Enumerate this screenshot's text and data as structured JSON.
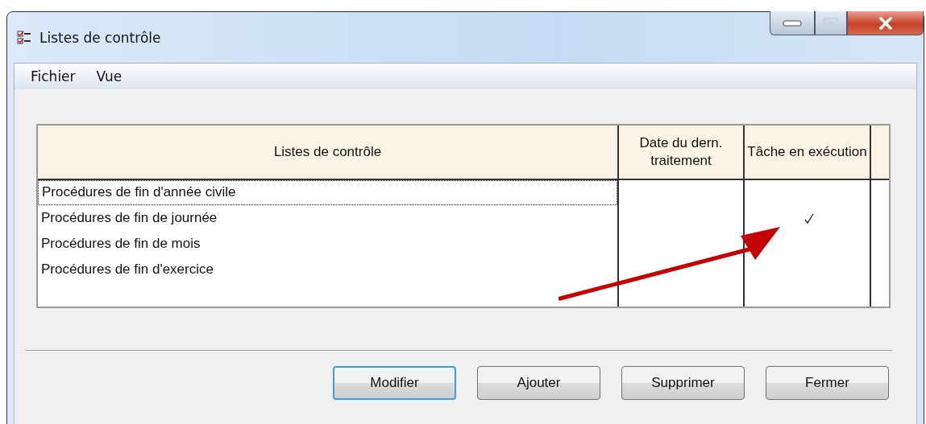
{
  "window": {
    "title": "Listes de contrôle"
  },
  "menu": [
    {
      "label": "Fichier"
    },
    {
      "label": "Vue"
    }
  ],
  "table": {
    "columns": [
      "Listes de contrôle",
      "Date du dern. traitement",
      "Tâche en exécution"
    ],
    "rows": [
      {
        "name": "Procédures de fin d'année civile",
        "focused": true,
        "running": false
      },
      {
        "name": "Procédures de fin de journée",
        "focused": false,
        "running": true
      },
      {
        "name": "Procédures de fin de mois",
        "focused": false,
        "running": false
      },
      {
        "name": "Procédures de fin d'exercice",
        "focused": false,
        "running": false
      }
    ]
  },
  "annotation": {
    "kind": "arrow"
  },
  "buttons": [
    {
      "label": "Modifier",
      "default": true
    },
    {
      "label": "Ajouter",
      "default": false
    },
    {
      "label": "Supprimer",
      "default": false
    },
    {
      "label": "Fermer",
      "default": false
    }
  ]
}
